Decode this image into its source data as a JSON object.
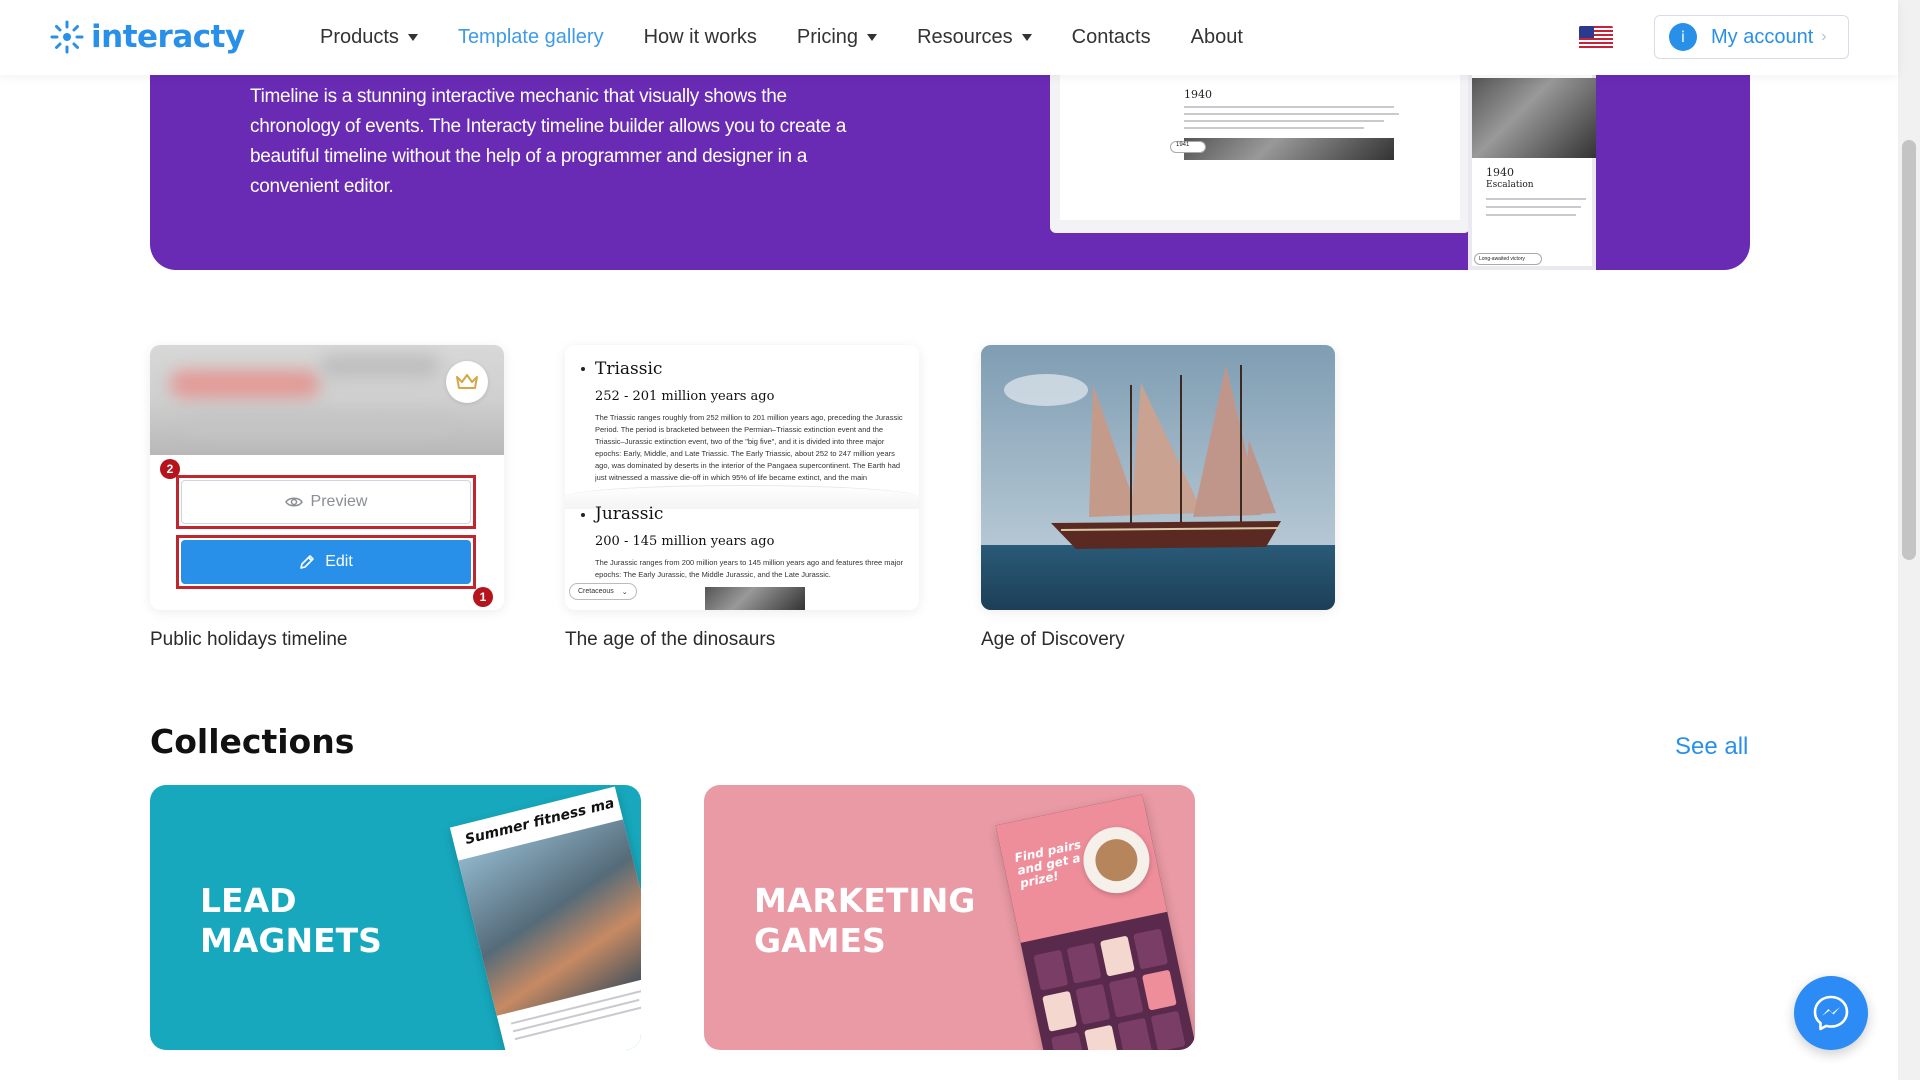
{
  "header": {
    "logo_text": "interacty",
    "nav": [
      {
        "label": "Products",
        "dropdown": true
      },
      {
        "label": "Template gallery",
        "active": true
      },
      {
        "label": "How it works"
      },
      {
        "label": "Pricing",
        "dropdown": true
      },
      {
        "label": "Resources",
        "dropdown": true
      },
      {
        "label": "Contacts"
      },
      {
        "label": "About"
      }
    ],
    "language_flag": "us-flag-icon",
    "account": {
      "avatar_letter": "i",
      "label": "My account"
    }
  },
  "hero": {
    "description": "Timeline is a stunning interactive mechanic that visually shows the chronology of events. The Interacty timeline builder allows you to create a beautiful timeline without the help of a programmer and designer in a convenient editor.",
    "laptop_year": "1940",
    "laptop_select": "1941",
    "phone_year": "1940",
    "phone_subtitle": "Escalation",
    "phone_select": "Long-awaited victory"
  },
  "templates": [
    {
      "title": "Public holidays timeline",
      "preview_label": "Preview",
      "edit_label": "Edit",
      "badge_preview": "2",
      "badge_edit": "1"
    },
    {
      "title": "The age of the dinosaurs",
      "sections": [
        {
          "heading": "Triassic",
          "subheading": "252 - 201 million years ago",
          "text": "The Triassic ranges roughly from 252 million to 201 million years ago, preceding the Jurassic Period. The period is bracketed between the Permian–Triassic extinction event and the Triassic–Jurassic extinction event, two of the \"big five\", and it is divided into three major epochs: Early, Middle, and Late Triassic. The Early Triassic, about 252 to 247 million years ago, was dominated by deserts in the interior of the Pangaea supercontinent. The Earth had just witnessed a massive die-off in which 95% of life became extinct, and the main"
        },
        {
          "heading": "Jurassic",
          "subheading": "200 - 145 million years ago",
          "text": "The Jurassic ranges from 200 million years to 145 million years ago and features three major epochs: The Early Jurassic, the Middle Jurassic, and the Late Jurassic."
        }
      ],
      "select_label": "Cretaceous"
    },
    {
      "title": "Age of Discovery"
    }
  ],
  "collections": {
    "heading": "Collections",
    "see_all": "See all",
    "items": [
      {
        "title": "LEAD\nMAGNETS",
        "color": "#17a8bd",
        "magazine_title": "Summer fitness ma"
      },
      {
        "title": "MARKETING\nGAMES",
        "color": "#e99aa4",
        "card_text": "Find pairs and get a prize!"
      }
    ]
  },
  "colors": {
    "brand": "#2990ea",
    "hero_purple": "#6a2bb4",
    "highlight_red": "#c0262d"
  }
}
